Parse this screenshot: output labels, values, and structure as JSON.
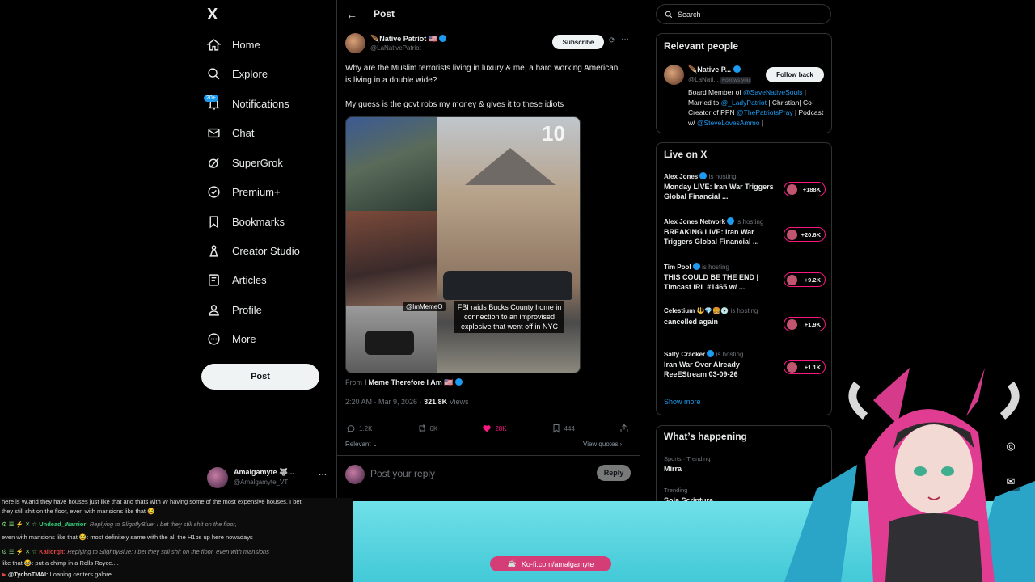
{
  "nav": {
    "logo": "X",
    "items": [
      {
        "label": "Home",
        "icon": "home-icon"
      },
      {
        "label": "Explore",
        "icon": "search-icon"
      },
      {
        "label": "Notifications",
        "icon": "bell-icon"
      },
      {
        "label": "Chat",
        "icon": "mail-icon"
      },
      {
        "label": "SuperGrok",
        "icon": "grok-icon"
      },
      {
        "label": "Premium+",
        "icon": "premium-icon"
      },
      {
        "label": "Bookmarks",
        "icon": "bookmark-icon"
      },
      {
        "label": "Creator Studio",
        "icon": "creator-icon"
      },
      {
        "label": "Articles",
        "icon": "articles-icon"
      },
      {
        "label": "Profile",
        "icon": "profile-icon"
      },
      {
        "label": "More",
        "icon": "more-circle-icon"
      }
    ],
    "notification_badge": "20+",
    "post_button": "Post",
    "account": {
      "name": "Amalgamyte 🐺...",
      "handle": "@Amalgamyte_VT"
    }
  },
  "post": {
    "header_title": "Post",
    "author_name": "🪶Native Patriot 🇺🇸",
    "author_handle": "@LaNativePatriot",
    "subscribe_label": "Subscribe",
    "text_1": "Why are the Muslim terrorists living in luxury & me, a hard working American is living in a double wide?",
    "text_2": "My guess is the govt robs my money & gives it to these idiots",
    "media_tag": "@ImMemeO",
    "media_caption": "FBI raids Bucks County home in connection to an improvised explosive that went off in NYC",
    "media_logo": "10",
    "from_prefix": "From",
    "from_name": "I Meme Therefore I Am 🇺🇸",
    "timestamp": "2:20 AM · Mar 9, 2026 ·",
    "views_count": "321.8K",
    "views_label": "Views",
    "replies": "1.2K",
    "reposts": "6K",
    "likes": "28K",
    "bookmarks": "444",
    "sort_label": "Relevant",
    "view_quotes": "View quotes",
    "reply_placeholder": "Post your reply",
    "reply_button": "Reply"
  },
  "sidebar": {
    "search_placeholder": "Search",
    "relevant_people_title": "Relevant people",
    "person": {
      "name": "🪶Native P...",
      "handle": "@LaNati...",
      "follows_you": "Follows you",
      "follow_button": "Follow back",
      "bio_1": "Board Member of ",
      "bio_link_1": "@SaveNativeSouls",
      "bio_2": " | Married to ",
      "bio_link_2": "@_LadyPatriot",
      "bio_3": " | Christian| Co-Creator of PPN ",
      "bio_link_3": "@ThePatriotsPray",
      "bio_4": " | Podcast w/ ",
      "bio_link_4": "@SteveLovesAmmo",
      "bio_5": " |"
    },
    "live_title": "Live on X",
    "live_hosting_label": "is hosting",
    "live": [
      {
        "host": "Alex Jones",
        "title": "Monday LIVE: Iran War Triggers Global Financial ...",
        "count": "+188K"
      },
      {
        "host": "Alex Jones Network",
        "title": "BREAKING LIVE: Iran War Triggers Global Financial ...",
        "count": "+20.6K"
      },
      {
        "host": "Tim Pool",
        "title": "THIS COULD BE THE END | Timcast IRL #1465 w/ ...",
        "count": "+9.2K"
      },
      {
        "host": "Celestium 🔱💎🍔💿",
        "title": "cancelled again",
        "count": "+1.9K"
      },
      {
        "host": "Salty Cracker",
        "title": "Iran War Over Already ReeEStream 03-09-26",
        "count": "+1.1K"
      }
    ],
    "show_more": "Show more",
    "happening_title": "What’s happening",
    "trend_1_meta": "Sports · Trending",
    "trend_1_name": "Mirra",
    "trend_2_meta": "Trending",
    "trend_2_name": "Sola Scriptura"
  },
  "stream": {
    "chat": [
      {
        "user": "",
        "text": "here is W.and they have houses just like that and thats with W having some of the most expensive houses. I bet"
      },
      {
        "user": "",
        "text": "they still shit on the floor, even with mansions like that 😂"
      },
      {
        "user": "Undead_Warrior:",
        "reply": "Replying to SlightlyBlue: I bet they still shit on the floor,",
        "text": ""
      },
      {
        "user": "",
        "text": "even with mansions like that 😂: most definitely same with the all the H1bs up here nowadays"
      },
      {
        "user": "Kaliorgit:",
        "reply": "Replying to SlightlyBlue: I bet they still shit on the floor, even with mansions",
        "text": ""
      },
      {
        "user": "",
        "text": "like that 😂: put a chimp in a Rolls Royce...."
      },
      {
        "user": "@TychoTMAI:",
        "text": "Loaning centers galore."
      }
    ],
    "kofi_label": "Ko-fi.com/amalgamyte"
  },
  "colors": {
    "accent": "#1d9bf0",
    "like": "#f91880",
    "overlay": "#43c9d7",
    "kofi": "#d53d77"
  }
}
